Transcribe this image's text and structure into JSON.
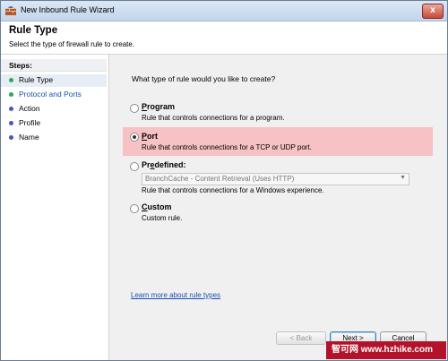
{
  "window": {
    "title": "New Inbound Rule Wizard",
    "close_label": "x",
    "icon": "firewall-icon"
  },
  "header": {
    "title": "Rule Type",
    "subtitle": "Select the type of firewall rule to create."
  },
  "sidebar": {
    "heading": "Steps:",
    "items": [
      {
        "label": "Rule Type",
        "dot_color": "#2fa84f",
        "current": true
      },
      {
        "label": "Protocol and Ports",
        "dot_color": "#2fa84f",
        "current": false
      },
      {
        "label": "Action",
        "dot_color": "#4a52c7",
        "current": false
      },
      {
        "label": "Profile",
        "dot_color": "#4a52c7",
        "current": false
      },
      {
        "label": "Name",
        "dot_color": "#4a52c7",
        "current": false
      }
    ]
  },
  "main": {
    "question": "What type of rule would you like to create?",
    "options": {
      "program": {
        "label_accel": "P",
        "label_rest": "rogram",
        "description": "Rule that controls connections for a program.",
        "checked": false
      },
      "port": {
        "label_accel": "P",
        "label_rest": "ort",
        "description": "Rule that controls connections for a TCP or UDP port.",
        "checked": true
      },
      "predefined": {
        "label_pre": "Pr",
        "label_accel": "e",
        "label_rest": "defined:",
        "dropdown_value": "BranchCache - Content Retrieval (Uses HTTP)",
        "description": "Rule that controls connections for a Windows experience.",
        "checked": false
      },
      "custom": {
        "label_accel": "C",
        "label_rest": "ustom",
        "description": "Custom rule.",
        "checked": false
      }
    },
    "learn_more": "Learn more about rule types"
  },
  "buttons": {
    "back": "< Back",
    "next": "Next >",
    "cancel": "Cancel"
  },
  "watermark": {
    "text": "智可网 www.hzhike.com"
  },
  "colors": {
    "highlight": "#f6c2c4",
    "link": "#1a4fb0",
    "watermark_bg": "#b3122a"
  }
}
